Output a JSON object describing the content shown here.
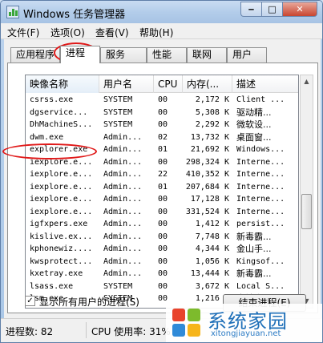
{
  "window": {
    "title": "Windows 任务管理器"
  },
  "menu": [
    "文件(F)",
    "选项(O)",
    "查看(V)",
    "帮助(H)"
  ],
  "tabs": [
    "应用程序",
    "进程",
    "服务",
    "性能",
    "联网",
    "用户"
  ],
  "active_tab": "进程",
  "columns": [
    "映像名称",
    "用户名",
    "CPU",
    "内存(...",
    "描述"
  ],
  "rows": [
    [
      "csrss.exe",
      "SYSTEM",
      "00",
      "2,172 K",
      "Client ..."
    ],
    [
      "dgservice...",
      "SYSTEM",
      "00",
      "5,308 K",
      "驱动精..."
    ],
    [
      "DhMachineS...",
      "SYSTEM",
      "00",
      "2,292 K",
      "微软设..."
    ],
    [
      "dwm.exe",
      "Admin...",
      "02",
      "13,732 K",
      "桌面窗..."
    ],
    [
      "explorer.exe",
      "Admin...",
      "01",
      "21,692 K",
      "Windows..."
    ],
    [
      "iexplore.e...",
      "Admin...",
      "00",
      "298,324 K",
      "Interne..."
    ],
    [
      "iexplore.e...",
      "Admin...",
      "22",
      "410,352 K",
      "Interne..."
    ],
    [
      "iexplore.e...",
      "Admin...",
      "01",
      "207,684 K",
      "Interne..."
    ],
    [
      "iexplore.e...",
      "Admin...",
      "00",
      "17,128 K",
      "Interne..."
    ],
    [
      "iexplore.e...",
      "Admin...",
      "00",
      "331,524 K",
      "Interne..."
    ],
    [
      "igfxpers.exe",
      "Admin...",
      "00",
      "1,412 K",
      "persist..."
    ],
    [
      "kislive.ex...",
      "Admin...",
      "00",
      "7,748 K",
      "新毒霸..."
    ],
    [
      "kphonewiz....",
      "Admin...",
      "00",
      "4,344 K",
      "金山手..."
    ],
    [
      "kwsprotect...",
      "Admin...",
      "00",
      "1,056 K",
      "Kingsof..."
    ],
    [
      "kxetray.exe",
      "Admin...",
      "00",
      "13,444 K",
      "新毒霸..."
    ],
    [
      "lsass.exe",
      "SYSTEM",
      "00",
      "3,672 K",
      "Local S..."
    ],
    [
      "lsm.exe",
      "SYSTEM",
      "00",
      "1,216 K",
      "本地会..."
    ]
  ],
  "show_all_label": "显示所有用户的进程(S)",
  "show_all_checked": "✓",
  "end_process_label": "结束进程(E)",
  "status": {
    "processes": "进程数: 82",
    "cpu": "CPU 使用率: 31%"
  },
  "watermark": {
    "text": "系统家园",
    "url": "xitongjiayuan.net"
  },
  "colors": {
    "annotation": "#e01818",
    "titlebar": "#b3cdea",
    "watermark": "#1e6fb8"
  }
}
